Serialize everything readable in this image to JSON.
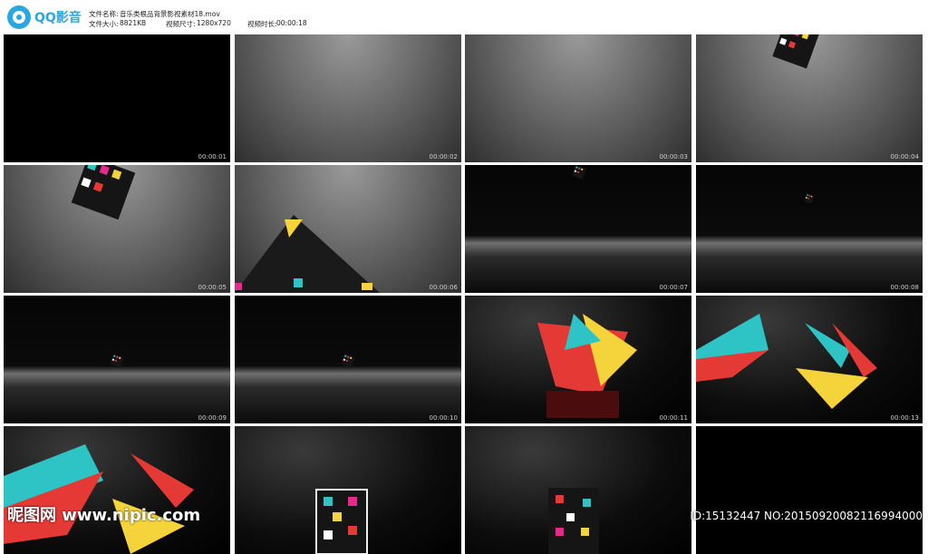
{
  "app": {
    "name": "QQ影音",
    "brand_color": "#29a7e1"
  },
  "file_info": {
    "name_label": "文件名称:",
    "name_value": "音乐类根品背景影视素材18.mov",
    "size_label": "文件大小:",
    "size_value": "8821KB",
    "dimensions_label": "视频尺寸:",
    "dimensions_value": "1280x720",
    "duration_label": "视频时长:",
    "duration_value": "00:00:18"
  },
  "thumbnails": [
    {
      "timestamp": "00:00:01",
      "scene": "black"
    },
    {
      "timestamp": "00:00:02",
      "scene": "gray"
    },
    {
      "timestamp": "00:00:03",
      "scene": "gray"
    },
    {
      "timestamp": "00:00:04",
      "scene": "gray-cube-top"
    },
    {
      "timestamp": "00:00:05",
      "scene": "gray-cube-left"
    },
    {
      "timestamp": "00:00:06",
      "scene": "gray-pyramid"
    },
    {
      "timestamp": "00:00:07",
      "scene": "dark-floor-small-cube-top"
    },
    {
      "timestamp": "00:00:08",
      "scene": "dark-floor-small-cube-mid"
    },
    {
      "timestamp": "00:00:09",
      "scene": "dark-floor-cube"
    },
    {
      "timestamp": "00:00:10",
      "scene": "dark-floor-cube"
    },
    {
      "timestamp": "00:00:11",
      "scene": "dark-shards"
    },
    {
      "timestamp": "00:00:13",
      "scene": "dark-shards-close"
    },
    {
      "timestamp": "",
      "scene": "dark-shards-close2"
    },
    {
      "timestamp": "",
      "scene": "dark-big-cube"
    },
    {
      "timestamp": "",
      "scene": "dark-big-cube2"
    },
    {
      "timestamp": "",
      "scene": "black"
    }
  ],
  "watermark": {
    "left": "昵图网 www.nipic.com",
    "right": "ID:15132447 NO:20150920082116994000"
  }
}
